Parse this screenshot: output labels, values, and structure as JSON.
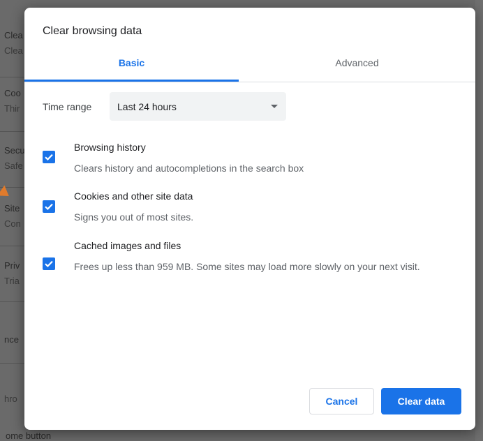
{
  "background": {
    "items": [
      {
        "title": "Clea",
        "sub": "Clea"
      },
      {
        "title": "Coo",
        "sub": "Thir"
      },
      {
        "title": "Secu",
        "sub": "Safe"
      },
      {
        "title": "Site",
        "sub": "Con"
      },
      {
        "title": "Priv",
        "sub": "Tria"
      },
      {
        "title": "nce",
        "sub": ""
      },
      {
        "title": "",
        "sub": "hro"
      }
    ],
    "bottom_text": "ome button"
  },
  "dialog": {
    "title": "Clear browsing data",
    "tabs": [
      {
        "label": "Basic",
        "selected": true
      },
      {
        "label": "Advanced",
        "selected": false
      }
    ],
    "time_range": {
      "label": "Time range",
      "value": "Last 24 hours"
    },
    "options": [
      {
        "title": "Browsing history",
        "description": "Clears history and autocompletions in the search box",
        "checked": true
      },
      {
        "title": "Cookies and other site data",
        "description": "Signs you out of most sites.",
        "checked": true
      },
      {
        "title": "Cached images and files",
        "description": "Frees up less than 959 MB. Some sites may load more slowly on your next visit.",
        "checked": true
      }
    ],
    "buttons": {
      "cancel": "Cancel",
      "clear": "Clear data"
    }
  },
  "colors": {
    "accent": "#1a73e8",
    "arrow": "#e07b2c"
  }
}
